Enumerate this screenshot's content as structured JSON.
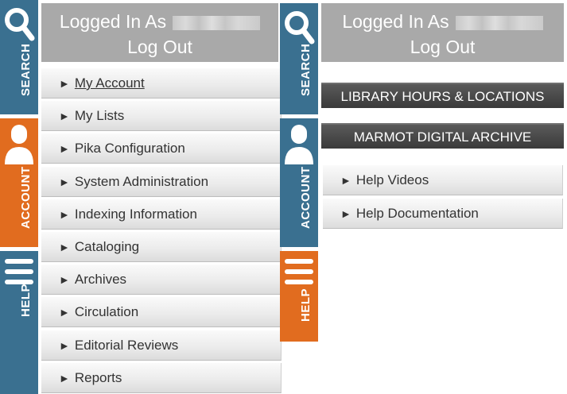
{
  "left": {
    "rail": {
      "search_label": "SEARCH",
      "account_label": "ACCOUNT",
      "help_label": "HELP"
    },
    "login": {
      "prefix": "Logged In As",
      "logout": "Log Out"
    },
    "menu": [
      {
        "label": "My Account"
      },
      {
        "label": "My Lists"
      },
      {
        "label": "Pika Configuration"
      },
      {
        "label": "System Administration"
      },
      {
        "label": "Indexing Information"
      },
      {
        "label": "Cataloging"
      },
      {
        "label": "Archives"
      },
      {
        "label": "Circulation"
      },
      {
        "label": "Editorial Reviews"
      },
      {
        "label": "Reports"
      }
    ]
  },
  "right": {
    "rail": {
      "search_label": "SEARCH",
      "account_label": "ACCOUNT",
      "help_label": "HELP"
    },
    "login": {
      "prefix": "Logged In As",
      "logout": "Log Out"
    },
    "bars": [
      {
        "label": "LIBRARY HOURS & LOCATIONS"
      },
      {
        "label": "MARMOT DIGITAL ARCHIVE"
      }
    ],
    "menu": [
      {
        "label": "Help Videos"
      },
      {
        "label": "Help Documentation"
      }
    ]
  },
  "colors": {
    "rail_blue": "#3a7090",
    "rail_orange": "#e16c1f",
    "login_gray": "#a9a9a9",
    "dark_bar": "#3a3a3a"
  },
  "arrow_glyph": "►"
}
